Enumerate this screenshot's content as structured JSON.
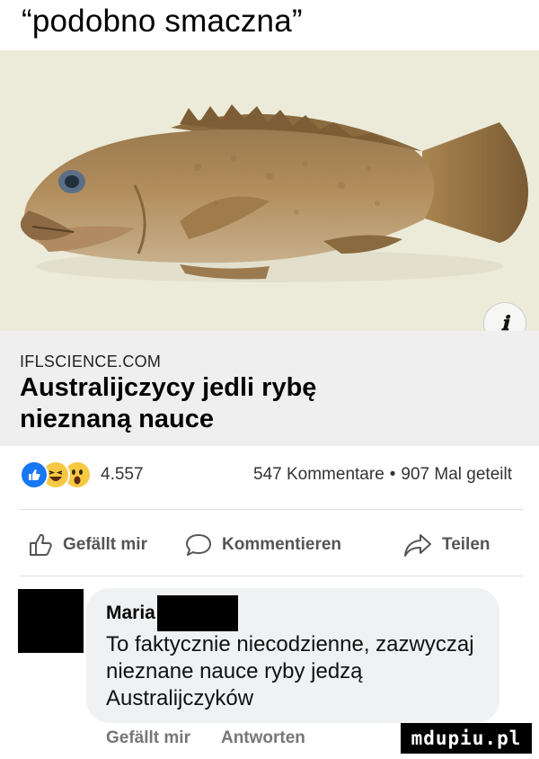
{
  "caption": "“podobno smaczna”",
  "link": {
    "image_subject": "grouper-fish-photo",
    "info_icon": "ℹ",
    "domain": "IFLSCIENCE.COM",
    "title": "Australijczycy jedli rybę nieznaną nauce"
  },
  "reactions": {
    "icons": [
      "like-icon",
      "haha-icon",
      "wow-icon"
    ],
    "count": "4.557"
  },
  "stats": {
    "comments": "547 Kommentare",
    "separator": "•",
    "shares": "907 Mal geteilt"
  },
  "actions": {
    "like": "Gefällt mir",
    "comment": "Kommentieren",
    "share": "Teilen"
  },
  "comment": {
    "author": "Maria",
    "text": "To faktycznie niecodzienne, zazwyczaj nieznane nauce ryby jedzą Australijczyków",
    "like_label": "Gefällt mir",
    "reply_label": "Antworten"
  },
  "watermark": "mdupiu.pl",
  "colors": {
    "like_blue": "#1877f2",
    "emoji_yellow": "#f7c844",
    "bubble_gray": "#eff1f3",
    "meta_gray": "#efefef"
  }
}
